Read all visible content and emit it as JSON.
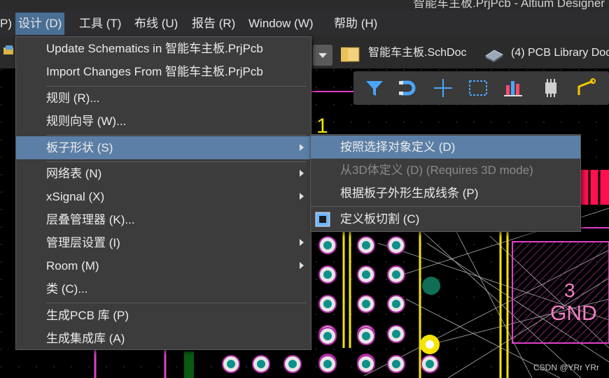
{
  "window": {
    "title": "智能车主板.PrjPcb - Altium Designer"
  },
  "menubar": {
    "items": [
      {
        "label": "P)"
      },
      {
        "label": "设计 (D)"
      },
      {
        "label": "工具 (T)"
      },
      {
        "label": "布线 (U)"
      },
      {
        "label": "报告 (R)"
      },
      {
        "label": "Window (W)"
      },
      {
        "label": "帮助 (H)"
      }
    ]
  },
  "doc_tabs": [
    {
      "label": "智能车主板.SchDoc",
      "icon": "schematic-doc-icon"
    },
    {
      "label": "(4) PCB Library Doc",
      "icon": "pcb-library-icon"
    }
  ],
  "design_menu": {
    "items": [
      {
        "label": "Update Schematics in 智能车主板.PrjPcb",
        "has_submenu": false
      },
      {
        "label": "Import Changes From 智能车主板.PrjPcb",
        "has_submenu": false
      },
      {
        "label": "规则 (R)...",
        "has_submenu": false
      },
      {
        "label": "规则向导 (W)...",
        "has_submenu": false
      },
      {
        "label": "板子形状 (S)",
        "has_submenu": true,
        "highlighted": true
      },
      {
        "label": "网络表 (N)",
        "has_submenu": true
      },
      {
        "label": "xSignal (X)",
        "has_submenu": true
      },
      {
        "label": "层叠管理器 (K)...",
        "has_submenu": false
      },
      {
        "label": "管理层设置 (I)",
        "has_submenu": true
      },
      {
        "label": "Room (M)",
        "has_submenu": true
      },
      {
        "label": "类 (C)...",
        "has_submenu": false
      },
      {
        "label": "生成PCB 库 (P)",
        "has_submenu": false
      },
      {
        "label": "生成集成库 (A)",
        "has_submenu": false
      }
    ]
  },
  "board_shape_submenu": {
    "items": [
      {
        "label": "按照选择对象定义 (D)",
        "highlighted": true,
        "disabled": false
      },
      {
        "label": "从3D体定义 (D) (Requires 3D mode)",
        "disabled": true
      },
      {
        "label": "根据板子外形生成线条 (P)",
        "disabled": false
      },
      {
        "label": "定义板切割 (C)",
        "disabled": false,
        "icon": "board-cutout-icon"
      }
    ]
  },
  "pcb_toolbar": {
    "icons": [
      "filter-icon",
      "magnet-icon",
      "move-cross-icon",
      "select-rect-icon",
      "align-icon",
      "component-icon",
      "route-icon"
    ]
  },
  "canvas": {
    "designator": "1",
    "pad_label_number": "3",
    "pad_label_net": "GND",
    "watermark": "CSDN @YRr YRr"
  },
  "colors": {
    "menu_highlight": "#5b7fa6",
    "menubar_active": "#4a6f95",
    "pad_ring": "#e6e6e6",
    "pad_hole": "#0f8f8a",
    "track_yellow": "#f5e400",
    "overlay_magenta": "#e040c8",
    "silk_red": "#ff1050"
  }
}
